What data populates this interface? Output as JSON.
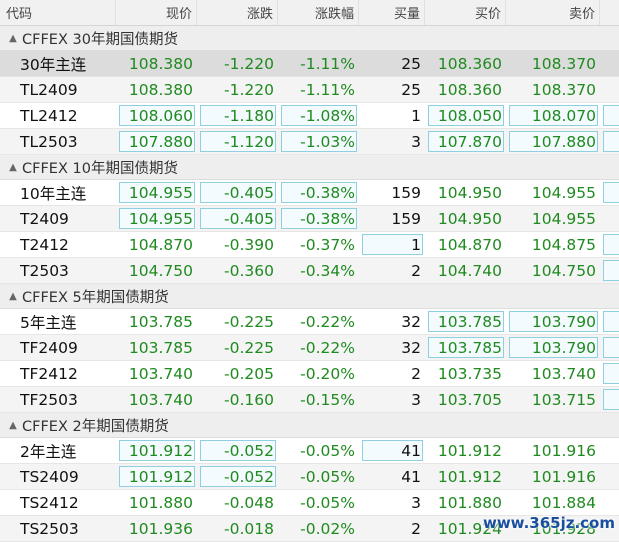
{
  "header": {
    "code": "代码",
    "price": "现价",
    "change": "涨跌",
    "change_pct": "涨跌幅",
    "bid_vol": "买量",
    "bid": "买价",
    "ask": "卖价"
  },
  "groups": [
    {
      "title": "CFFEX 30年期国债期货",
      "rows": [
        {
          "code": "30年主连",
          "price": "108.380",
          "change": "-1.220",
          "pct": "-1.11%",
          "vol": "25",
          "bid": "108.360",
          "ask": "108.370"
        },
        {
          "code": "TL2409",
          "price": "108.380",
          "change": "-1.220",
          "pct": "-1.11%",
          "vol": "25",
          "bid": "108.360",
          "ask": "108.370"
        },
        {
          "code": "TL2412",
          "price": "108.060",
          "change": "-1.180",
          "pct": "-1.08%",
          "vol": "1",
          "bid": "108.050",
          "ask": "108.070"
        },
        {
          "code": "TL2503",
          "price": "107.880",
          "change": "-1.120",
          "pct": "-1.03%",
          "vol": "3",
          "bid": "107.870",
          "ask": "107.880"
        }
      ]
    },
    {
      "title": "CFFEX 10年期国债期货",
      "rows": [
        {
          "code": "10年主连",
          "price": "104.955",
          "change": "-0.405",
          "pct": "-0.38%",
          "vol": "159",
          "bid": "104.950",
          "ask": "104.955"
        },
        {
          "code": "T2409",
          "price": "104.955",
          "change": "-0.405",
          "pct": "-0.38%",
          "vol": "159",
          "bid": "104.950",
          "ask": "104.955"
        },
        {
          "code": "T2412",
          "price": "104.870",
          "change": "-0.390",
          "pct": "-0.37%",
          "vol": "1",
          "bid": "104.870",
          "ask": "104.875"
        },
        {
          "code": "T2503",
          "price": "104.750",
          "change": "-0.360",
          "pct": "-0.34%",
          "vol": "2",
          "bid": "104.740",
          "ask": "104.750"
        }
      ]
    },
    {
      "title": "CFFEX 5年期国债期货",
      "rows": [
        {
          "code": "5年主连",
          "price": "103.785",
          "change": "-0.225",
          "pct": "-0.22%",
          "vol": "32",
          "bid": "103.785",
          "ask": "103.790"
        },
        {
          "code": "TF2409",
          "price": "103.785",
          "change": "-0.225",
          "pct": "-0.22%",
          "vol": "32",
          "bid": "103.785",
          "ask": "103.790"
        },
        {
          "code": "TF2412",
          "price": "103.740",
          "change": "-0.205",
          "pct": "-0.20%",
          "vol": "2",
          "bid": "103.735",
          "ask": "103.740"
        },
        {
          "code": "TF2503",
          "price": "103.740",
          "change": "-0.160",
          "pct": "-0.15%",
          "vol": "3",
          "bid": "103.705",
          "ask": "103.715"
        }
      ]
    },
    {
      "title": "CFFEX 2年期国债期货",
      "rows": [
        {
          "code": "2年主连",
          "price": "101.912",
          "change": "-0.052",
          "pct": "-0.05%",
          "vol": "41",
          "bid": "101.912",
          "ask": "101.916"
        },
        {
          "code": "TS2409",
          "price": "101.912",
          "change": "-0.052",
          "pct": "-0.05%",
          "vol": "41",
          "bid": "101.912",
          "ask": "101.916"
        },
        {
          "code": "TS2412",
          "price": "101.880",
          "change": "-0.048",
          "pct": "-0.05%",
          "vol": "3",
          "bid": "101.880",
          "ask": "101.884"
        },
        {
          "code": "TS2503",
          "price": "101.936",
          "change": "-0.018",
          "pct": "-0.02%",
          "vol": "2",
          "bid": "101.924",
          "ask": "101.928"
        }
      ]
    }
  ],
  "watermark": "www.365jz.com",
  "colors": {
    "up_down_green": "#1f8a1f",
    "highlight_border": "#8fcfe0",
    "selected_row": "#dcdcdc"
  }
}
